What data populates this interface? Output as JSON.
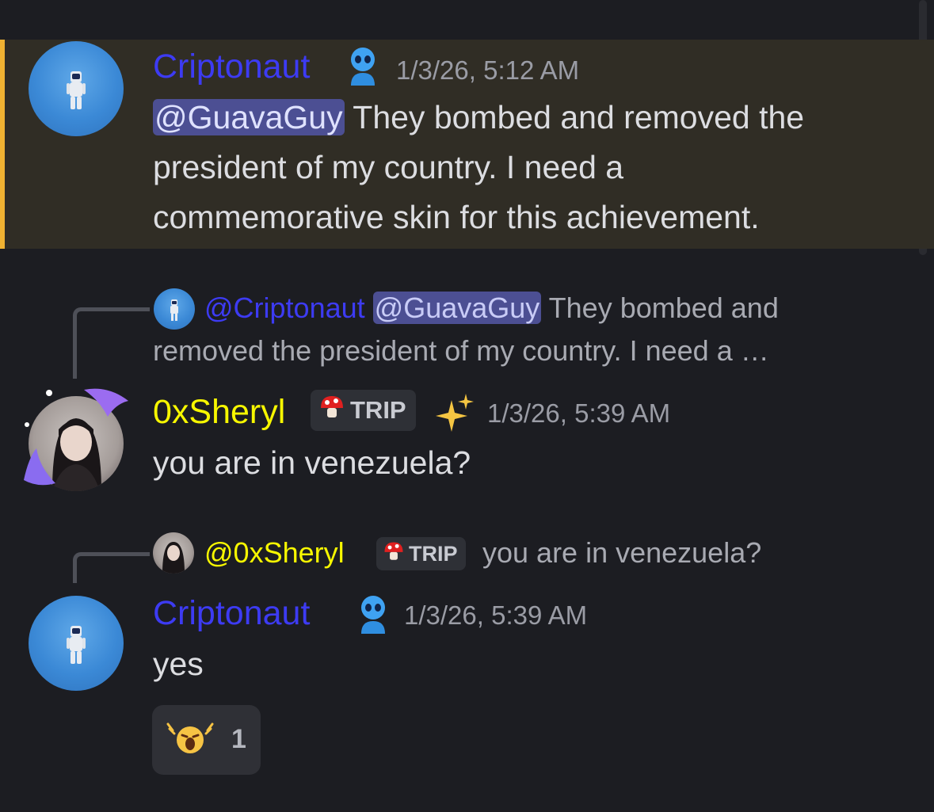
{
  "messages": [
    {
      "author": "Criptonaut",
      "timestamp": "1/3/26, 5:12 AM",
      "mention": "@GuavaGuy",
      "text_line1": "They bombed and removed the",
      "text_line2": "president of my country. I need a",
      "text_line3": "commemorative skin for this achievement.",
      "badge_icon": "blue-alien-icon",
      "highlight_color": "#f0b232"
    },
    {
      "reply": {
        "author": "@Criptonaut",
        "mention": "@GuavaGuy",
        "text_line1": "They bombed and",
        "text_line2": "removed the president of my country. I need a …"
      },
      "author": "0xSheryl",
      "tag_label": "TRIP",
      "tag_icon": "mushroom-icon",
      "extra_icon": "sparkles-icon",
      "timestamp": "1/3/26, 5:39 AM",
      "text": "you are in venezuela?"
    },
    {
      "reply": {
        "author": "@0xSheryl",
        "tag_label": "TRIP",
        "text": "you are in venezuela?"
      },
      "author": "Criptonaut",
      "badge_icon": "blue-alien-icon",
      "timestamp": "1/3/26, 5:39 AM",
      "text": "yes",
      "reaction": {
        "icon": "crying-face-icon",
        "count": "1"
      }
    }
  ],
  "colors": {
    "background": "#1c1d22",
    "name_blue": "#3d3bf3",
    "name_yellow": "#f7f700",
    "mention_bg": "#4c4f93"
  }
}
